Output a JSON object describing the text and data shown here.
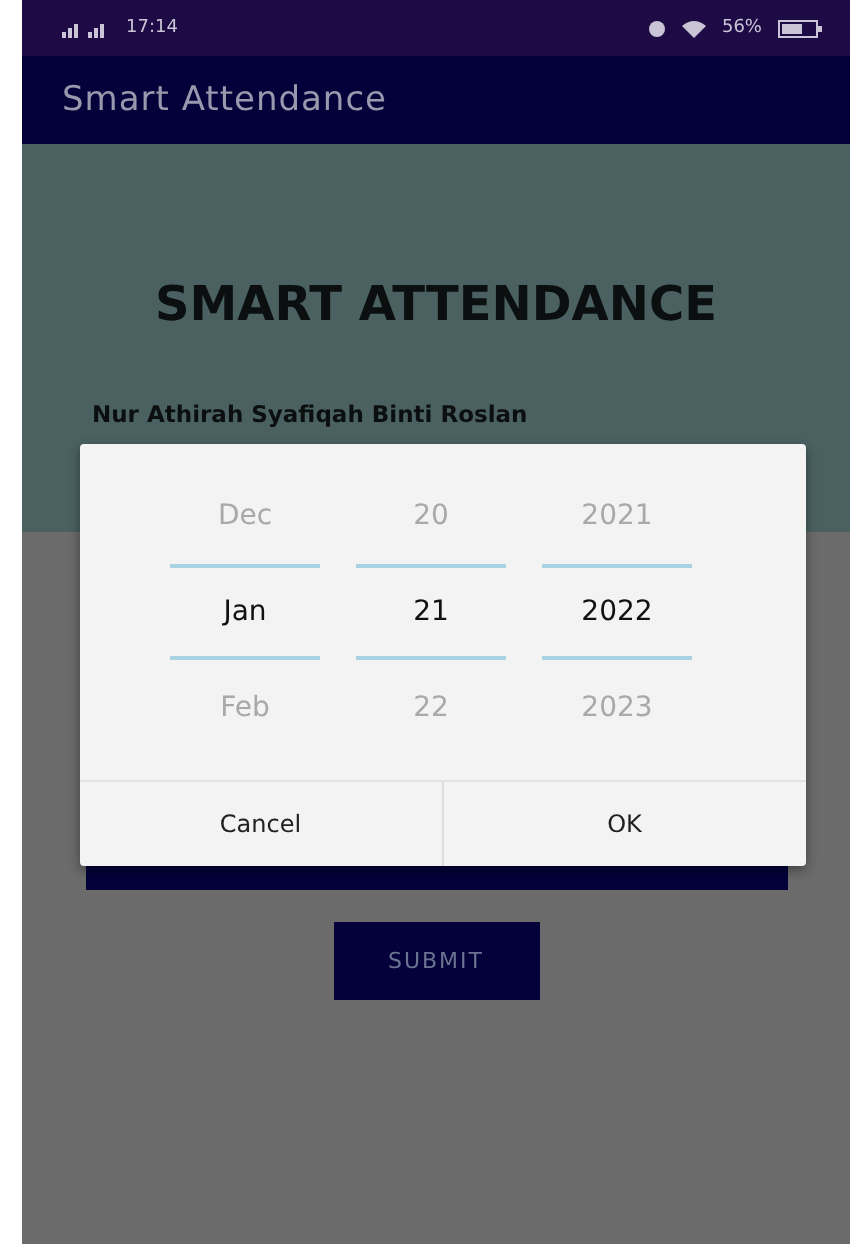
{
  "status_bar": {
    "time": "17:14",
    "battery": "56%"
  },
  "app_bar": {
    "title": "Smart Attendance"
  },
  "heading": "SMART ATTENDANCE",
  "name": "Nur Athirah Syafiqah Binti Roslan",
  "date_picker": {
    "columns": [
      {
        "items": [
          {
            "label": "Dec",
            "selected": false
          },
          {
            "label": "Jan",
            "selected": true
          },
          {
            "label": "Feb",
            "selected": false
          }
        ]
      },
      {
        "items": [
          {
            "label": "20",
            "selected": false
          },
          {
            "label": "21",
            "selected": true
          },
          {
            "label": "22",
            "selected": false
          }
        ]
      },
      {
        "items": [
          {
            "label": "2021",
            "selected": false
          },
          {
            "label": "2022",
            "selected": true
          },
          {
            "label": "2023",
            "selected": false
          }
        ]
      }
    ],
    "buttons": [
      "Cancel",
      "OK"
    ]
  },
  "submit_button": "SUBMIT"
}
